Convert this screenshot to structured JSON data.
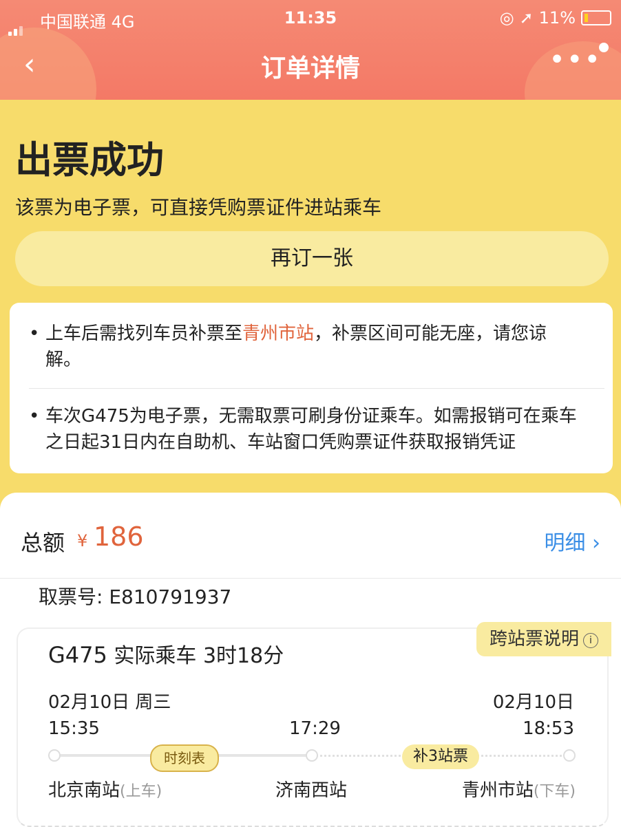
{
  "status_bar": {
    "carrier": "中国联通  4G",
    "time": "11:35",
    "battery": "11%"
  },
  "nav": {
    "back_icon": "‹",
    "title": "订单详情",
    "more_icon": "•••"
  },
  "result": {
    "title": "出票成功",
    "subtitle": "该票为电子票，可直接凭购票证件进站乘车",
    "rebook_label": "再订一张"
  },
  "notices": {
    "n1_before": "上车后需找列车员补票至",
    "n1_highlight": "青州市站",
    "n1_after": "，补票区间可能无座，请您谅解。",
    "n2": "车次G475为电子票，无需取票可刷身份证乘车。如需报销可在乘车之日起31日内在自助机、车站窗口凭购票证件获取报销凭证",
    "bullet": "•"
  },
  "total": {
    "label": "总额",
    "currency": "¥",
    "amount": "186",
    "detail_label": "明细 ›"
  },
  "pickup": "取票号: E810791937",
  "train": {
    "number": "G475",
    "duration": "实际乘车  3时18分",
    "cross_tip": "跨站票说明",
    "info_icon": "i",
    "date_depart": "02月10日 周三",
    "date_arrive": "02月10日",
    "time_depart": "15:35",
    "time_mid": "17:29",
    "time_arrive": "18:53",
    "schedule_label": "时刻表",
    "supp_label": "补3站票",
    "station_depart": "北京南站",
    "station_depart_tag": "(上车)",
    "station_mid": "济南西站",
    "station_arrive": "青州市站",
    "station_arrive_tag": "(下车)"
  },
  "colors": {
    "accent_orange": "#e0643c",
    "link_blue": "#3a8ee6",
    "yellow_bg": "#f7dc6b"
  }
}
